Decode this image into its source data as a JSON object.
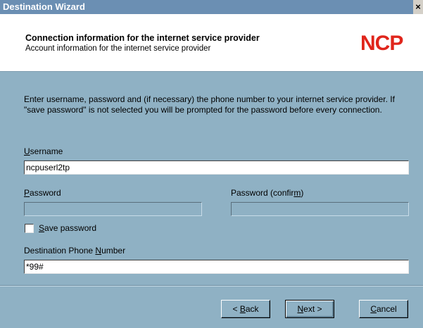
{
  "window": {
    "title": "Destination Wizard",
    "close_glyph": "×"
  },
  "header": {
    "title": "Connection information for the internet service provider",
    "subtitle": "Account information for the internet service provider",
    "logo_text": "NCP",
    "logo_color": "#e0251b"
  },
  "intro": "Enter username, password and (if necessary) the phone number to your internet service provider. If \"save password\" is not selected you will be prompted for the password before every connection.",
  "form": {
    "username": {
      "label_pre": "",
      "label_key": "U",
      "label_post": "sername",
      "value": "ncpuserl2tp"
    },
    "password": {
      "label_pre": "",
      "label_key": "P",
      "label_post": "assword",
      "value": ""
    },
    "password_confirm": {
      "label_pre": "Password (confir",
      "label_key": "m",
      "label_post": ")",
      "value": ""
    },
    "save_password": {
      "label_pre": "",
      "label_key": "S",
      "label_post": "ave password",
      "checked": false
    },
    "phone": {
      "label_pre": "Destination Phone ",
      "label_key": "N",
      "label_post": "umber",
      "value": "*99#"
    }
  },
  "buttons": {
    "back": {
      "pre": "< ",
      "key": "B",
      "post": "ack"
    },
    "next": {
      "pre": "",
      "key": "N",
      "post": "ext >"
    },
    "cancel": {
      "pre": "",
      "key": "C",
      "post": "ancel"
    }
  }
}
